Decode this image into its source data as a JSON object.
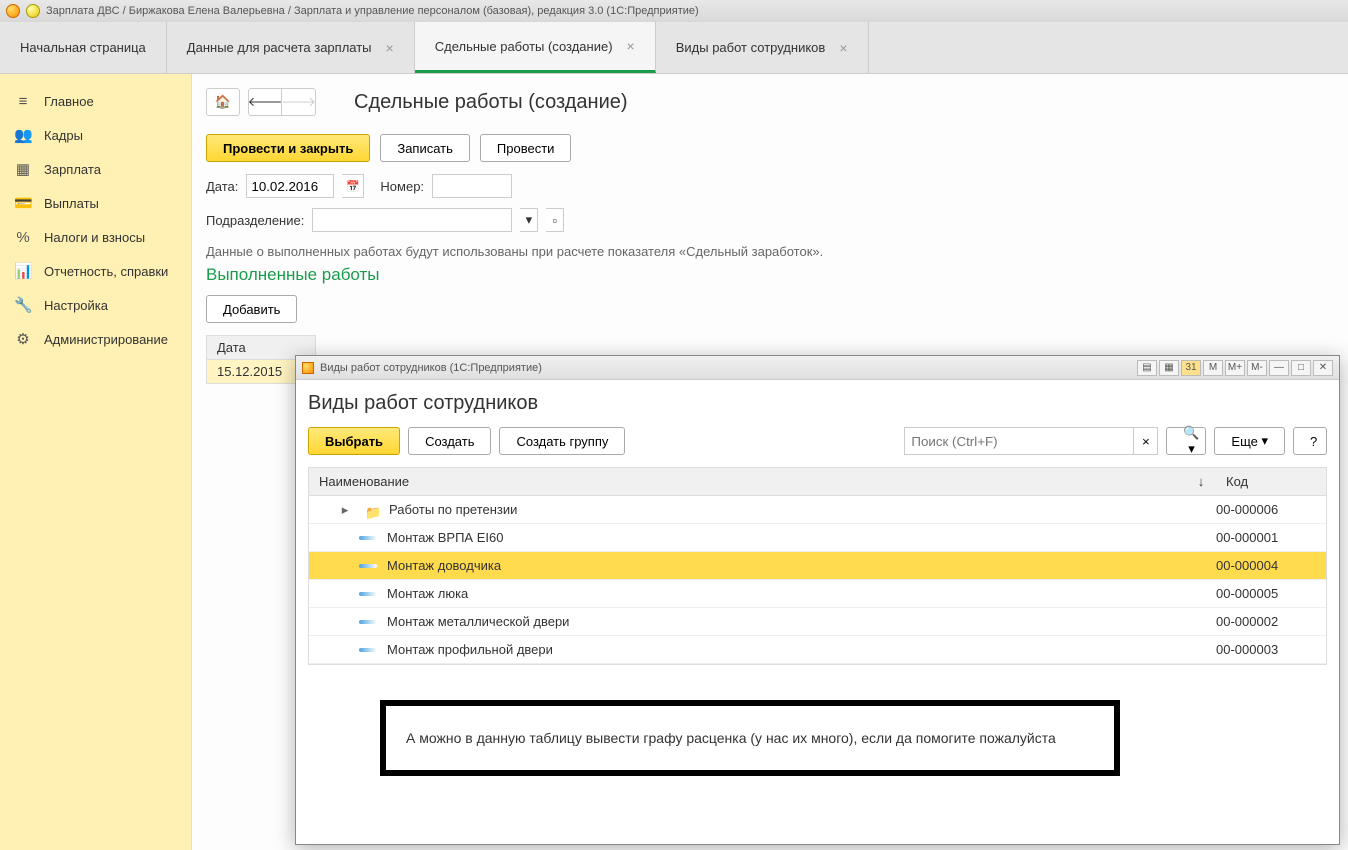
{
  "app_title": "Зарплата ДВС / Биржакова Елена Валерьевна / Зарплата и управление персоналом (базовая), редакция 3.0  (1С:Предприятие)",
  "tabs": [
    {
      "label": "Начальная страница",
      "closable": false
    },
    {
      "label": "Данные для расчета зарплаты",
      "closable": true
    },
    {
      "label": "Сдельные работы (создание)",
      "closable": true,
      "active": true
    },
    {
      "label": "Виды работ сотрудников",
      "closable": true
    }
  ],
  "sidebar": [
    {
      "icon": "≡",
      "label": "Главное"
    },
    {
      "icon": "👥",
      "label": "Кадры"
    },
    {
      "icon": "▦",
      "label": "Зарплата"
    },
    {
      "icon": "💳",
      "label": "Выплаты"
    },
    {
      "icon": "%",
      "label": "Налоги и взносы"
    },
    {
      "icon": "📊",
      "label": "Отчетность, справки"
    },
    {
      "icon": "🔧",
      "label": "Настройка"
    },
    {
      "icon": "⚙",
      "label": "Администрирование"
    }
  ],
  "page": {
    "title": "Сдельные работы (создание)",
    "btn_post_close": "Провести и закрыть",
    "btn_write": "Записать",
    "btn_post": "Провести",
    "label_date": "Дата:",
    "value_date": "10.02.2016",
    "label_number": "Номер:",
    "value_number": "",
    "label_podr": "Подразделение:",
    "value_podr": "",
    "info_text": "Данные о выполненных работах будут использованы при расчете показателя «Сдельный заработок».",
    "section_title": "Выполненные работы",
    "btn_add": "Добавить",
    "table_hdr_date": "Дата",
    "table_row_date": "15.12.2015"
  },
  "dialog": {
    "window_title": "Виды работ сотрудников  (1С:Предприятие)",
    "title": "Виды работ сотрудников",
    "btn_select": "Выбрать",
    "btn_create": "Создать",
    "btn_create_group": "Создать группу",
    "search_placeholder": "Поиск (Ctrl+F)",
    "btn_more": "Еще",
    "hdr_name": "Наименование",
    "hdr_code": "Код",
    "calc_btns": [
      "M",
      "M+",
      "M-"
    ],
    "rows": [
      {
        "type": "folder",
        "name": "Работы по претензии",
        "code": "00-000006"
      },
      {
        "type": "item",
        "name": "Монтаж ВРПА EI60",
        "code": "00-000001"
      },
      {
        "type": "item",
        "name": "Монтаж доводчика",
        "code": "00-000004",
        "selected": true
      },
      {
        "type": "item",
        "name": "Монтаж люка",
        "code": "00-000005"
      },
      {
        "type": "item",
        "name": "Монтаж металлической двери",
        "code": "00-000002"
      },
      {
        "type": "item",
        "name": "Монтаж профильной двери",
        "code": "00-000003"
      }
    ]
  },
  "annotation": "А можно в данную таблицу вывести графу расценка (у нас их много), если да помогите пожалуйста"
}
